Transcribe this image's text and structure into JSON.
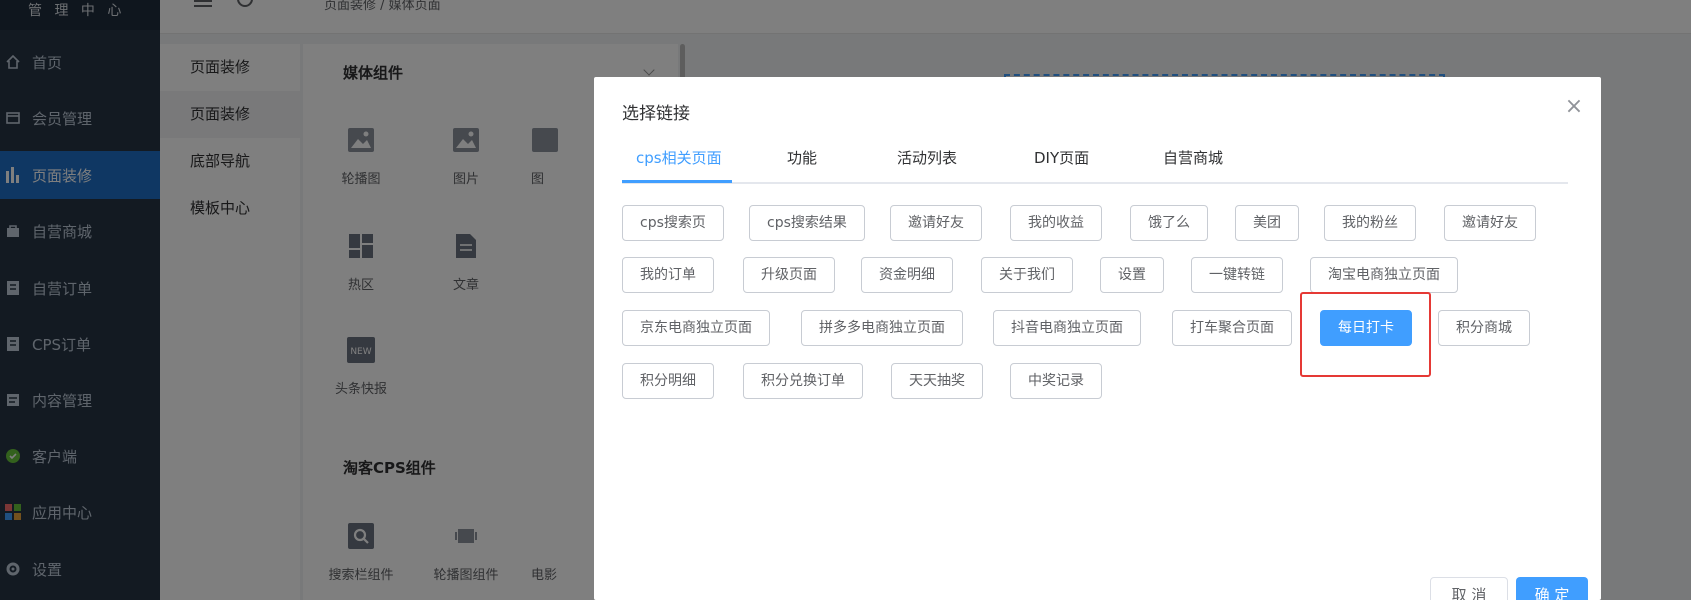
{
  "sidebar": {
    "brand": "管 理 中 心",
    "items": [
      {
        "label": "首页",
        "icon": "home-icon"
      },
      {
        "label": "会员管理",
        "icon": "member-icon"
      },
      {
        "label": "页面装修",
        "icon": "chart-icon"
      },
      {
        "label": "自营商城",
        "icon": "shop-icon"
      },
      {
        "label": "自营订单",
        "icon": "order-icon"
      },
      {
        "label": "CPS订单",
        "icon": "cps-order-icon"
      },
      {
        "label": "内容管理",
        "icon": "content-icon"
      },
      {
        "label": "客户端",
        "icon": "client-icon"
      },
      {
        "label": "应用中心",
        "icon": "apps-icon"
      },
      {
        "label": "设置",
        "icon": "gear-icon"
      }
    ],
    "active_index": 2
  },
  "header": {
    "breadcrumb": "页面装修 / 媒体页面"
  },
  "submenu": {
    "items": [
      "页面装修",
      "页面装修",
      "底部导航",
      "模板中心"
    ],
    "active_index": 1
  },
  "panel": {
    "media_title": "媒体组件",
    "media_items": [
      {
        "label": "轮播图",
        "icon": "carousel-image-icon"
      },
      {
        "label": "图片",
        "icon": "image-icon"
      },
      {
        "label": "图",
        "icon": "image-icon"
      },
      {
        "label": "热区",
        "icon": "hotzone-icon"
      },
      {
        "label": "文章",
        "icon": "article-icon"
      },
      {
        "label": "头条快报",
        "icon": "news-icon"
      }
    ],
    "taoke_title": "淘客CPS组件",
    "taoke_items": [
      {
        "label": "搜索栏组件",
        "icon": "search-icon"
      },
      {
        "label": "轮播图组件",
        "icon": "carousel-icon"
      },
      {
        "label": "电影",
        "icon": "movie-icon"
      }
    ]
  },
  "modal": {
    "title": "选择链接",
    "tabs": [
      "cps相关页面",
      "功能",
      "活动列表",
      "DIY页面",
      "自营商城"
    ],
    "active_tab": 0,
    "links": [
      [
        "cps搜索页",
        "cps搜索结果",
        "邀请好友",
        "我的收益",
        "饿了么",
        "美团",
        "我的粉丝",
        "邀请好友"
      ],
      [
        "我的订单",
        "升级页面",
        "资金明细",
        "关于我们",
        "设置",
        "一键转链",
        "淘宝电商独立页面"
      ],
      [
        "京东电商独立页面",
        "拼多多电商独立页面",
        "抖音电商独立页面",
        "打车聚合页面",
        "每日打卡",
        "积分商城"
      ],
      [
        "积分明细",
        "积分兑换订单",
        "天天抽奖",
        "中奖记录"
      ]
    ],
    "selected_link": "每日打卡",
    "cancel_label": "取 消",
    "confirm_label": "确 定"
  },
  "colors": {
    "accent": "#409eff",
    "sidebar_bg": "#263445",
    "highlight_border": "#e53935"
  }
}
